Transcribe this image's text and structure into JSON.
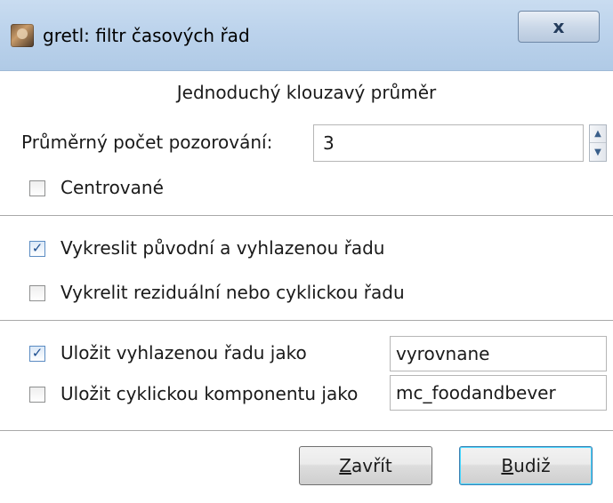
{
  "window": {
    "title": "gretl: filtr časových řad",
    "close_glyph": "x",
    "app_icon": "gretl-app-icon"
  },
  "dialog": {
    "heading": "Jednoduchý klouzavý průměr"
  },
  "average": {
    "label": "Průměrný počet pozorování:",
    "value": "3",
    "spin_up": "▲",
    "spin_down": "▼"
  },
  "centered": {
    "label": "Centrované",
    "checked": false
  },
  "plot_options": [
    {
      "label": "Vykreslit původní a vyhlazenou řadu",
      "checked": true
    },
    {
      "label": "Vykrelit reziduální nebo cyklickou řadu",
      "checked": false
    }
  ],
  "save_options": [
    {
      "label": "Uložit vyhlazenou řadu jako",
      "checked": true,
      "value": "vyrovnane"
    },
    {
      "label": "Uložit cyklickou komponentu jako",
      "checked": false,
      "value": "mc_foodandbever"
    }
  ],
  "buttons": {
    "close_accel": "Z",
    "close_rest": "avřít",
    "ok_accel": "B",
    "ok_rest": "udiž"
  },
  "check_glyph": "✓",
  "colors": {
    "titlebar": "#bcd3ec",
    "default_button_focus": "#48d8ff",
    "checkmark": "#1d4f91"
  }
}
